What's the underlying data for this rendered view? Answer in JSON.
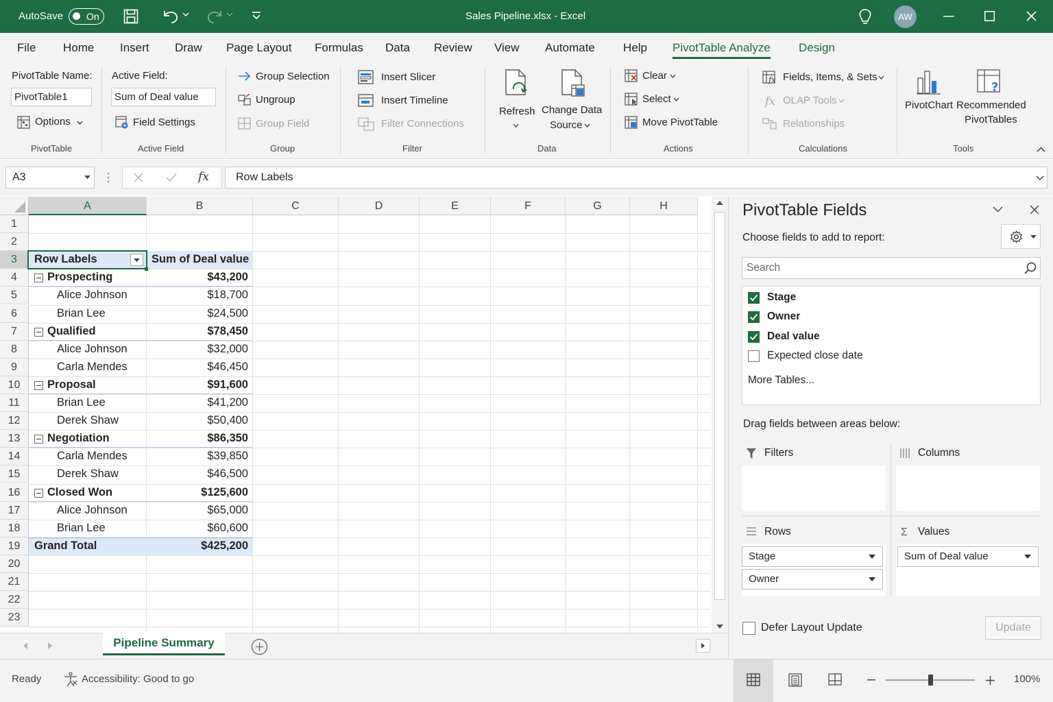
{
  "titlebar": {
    "autosave_label": "AutoSave",
    "toggle_state": "On",
    "title": "Sales Pipeline.xlsx  -  Excel",
    "avatar": "AW"
  },
  "tabs": [
    "File",
    "Home",
    "Insert",
    "Draw",
    "Page Layout",
    "Formulas",
    "Data",
    "Review",
    "View",
    "Automate",
    "Help",
    "PivotTable Analyze",
    "Design"
  ],
  "active_tab": "PivotTable Analyze",
  "ribbon": {
    "pivottable": {
      "name_label": "PivotTable Name:",
      "name_value": "PivotTable1",
      "options": "Options",
      "group": "PivotTable"
    },
    "active_field": {
      "label": "Active Field:",
      "value": "Sum of Deal value",
      "settings": "Field Settings",
      "group": "Active Field"
    },
    "group": {
      "selection": "Group Selection",
      "ungroup": "Ungroup",
      "field": "Group Field",
      "group": "Group"
    },
    "filter": {
      "slicer": "Insert Slicer",
      "timeline": "Insert Timeline",
      "connections": "Filter Connections",
      "group": "Filter"
    },
    "data": {
      "refresh": "Refresh",
      "change1": "Change Data",
      "change2": "Source",
      "group": "Data"
    },
    "actions": {
      "clear": "Clear",
      "select": "Select",
      "move": "Move PivotTable",
      "group": "Actions"
    },
    "calculations": {
      "fields": "Fields, Items, & Sets",
      "olap": "OLAP Tools",
      "relationships": "Relationships",
      "group": "Calculations"
    },
    "tools": {
      "pivotchart": "PivotChart",
      "rec1": "Recommended",
      "rec2": "PivotTables",
      "group": "Tools"
    }
  },
  "formula_bar": {
    "name_box": "A3",
    "fx": "fx",
    "formula": "Row Labels"
  },
  "grid": {
    "columns": [
      "A",
      "B",
      "C",
      "D",
      "E",
      "F",
      "G",
      "H"
    ],
    "rows": [
      "1",
      "2",
      "3",
      "4",
      "5",
      "6",
      "7",
      "8",
      "9",
      "10",
      "11",
      "12",
      "13",
      "14",
      "15",
      "16",
      "17",
      "18",
      "19",
      "20",
      "21",
      "22",
      "23"
    ],
    "header": {
      "row_labels": "Row Labels",
      "sum_label": "Sum of Deal value"
    },
    "pivot_rows": [
      {
        "label": "Prospecting",
        "value": "$43,200",
        "level": "stage"
      },
      {
        "label": "Alice Johnson",
        "value": "$18,700",
        "level": "owner"
      },
      {
        "label": "Brian Lee",
        "value": "$24,500",
        "level": "owner"
      },
      {
        "label": "Qualified",
        "value": "$78,450",
        "level": "stage"
      },
      {
        "label": "Alice Johnson",
        "value": "$32,000",
        "level": "owner"
      },
      {
        "label": "Carla Mendes",
        "value": "$46,450",
        "level": "owner"
      },
      {
        "label": "Proposal",
        "value": "$91,600",
        "level": "stage"
      },
      {
        "label": "Brian Lee",
        "value": "$41,200",
        "level": "owner"
      },
      {
        "label": "Derek Shaw",
        "value": "$50,400",
        "level": "owner"
      },
      {
        "label": "Negotiation",
        "value": "$86,350",
        "level": "stage"
      },
      {
        "label": "Carla Mendes",
        "value": "$39,850",
        "level": "owner"
      },
      {
        "label": "Derek Shaw",
        "value": "$46,500",
        "level": "owner"
      },
      {
        "label": "Closed Won",
        "value": "$125,600",
        "level": "stage"
      },
      {
        "label": "Alice Johnson",
        "value": "$65,000",
        "level": "owner"
      },
      {
        "label": "Brian Lee",
        "value": "$60,600",
        "level": "owner"
      }
    ],
    "grand_total": {
      "label": "Grand Total",
      "value": "$425,200"
    }
  },
  "sheet_tab": "Pipeline Summary",
  "pane": {
    "title": "PivotTable Fields",
    "subtitle": "Choose fields to add to report:",
    "search_placeholder": "Search",
    "fields": [
      {
        "name": "Stage",
        "checked": true
      },
      {
        "name": "Owner",
        "checked": true
      },
      {
        "name": "Deal value",
        "checked": true
      },
      {
        "name": "Expected close date",
        "checked": false
      }
    ],
    "more_tables": "More Tables...",
    "drag_hint": "Drag fields between areas below:",
    "filters": "Filters",
    "columns": "Columns",
    "rows": "Rows",
    "values": "Values",
    "row_items": [
      "Stage",
      "Owner"
    ],
    "value_items": [
      "Sum of Deal value"
    ],
    "defer": "Defer Layout Update",
    "update": "Update"
  },
  "status": {
    "ready": "Ready",
    "accessibility": "Accessibility: Good to go",
    "zoom": "100%",
    "zoom_level": 0.5
  },
  "colors": {
    "accent": "#1e6c41",
    "pivot_header": "#dde9f7",
    "grand_total": "#dde9f7"
  }
}
